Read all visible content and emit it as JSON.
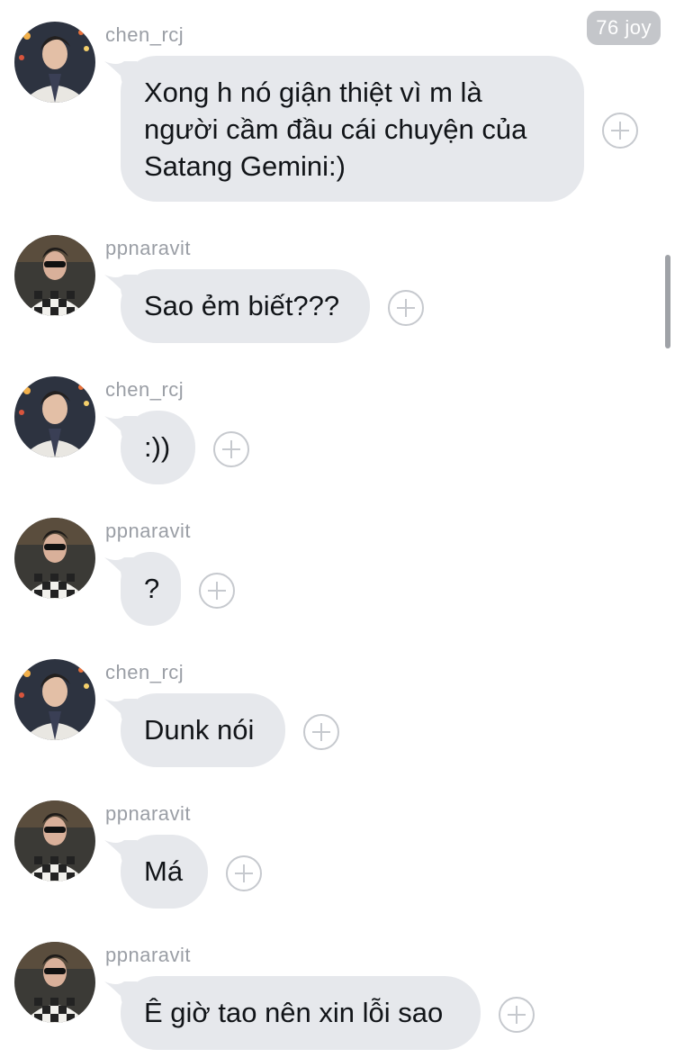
{
  "header": {
    "points_badge": "76 joy"
  },
  "colors": {
    "bubble_bg": "#e6e8ec",
    "username_text": "#9a9ea5",
    "react_button": "#c6c9ce",
    "badge_bg": "#c4c6ca"
  },
  "avatar_icons": {
    "chen_rcj": "user-avatar-chen-icon",
    "ppnaravit": "user-avatar-pp-icon"
  },
  "messages": [
    {
      "username": "chen_rcj",
      "text": "Xong h nó giận thiệt vì m là người cầm đầu cái chuyện của Satang Gemini:)"
    },
    {
      "username": "ppnaravit",
      "text": "Sao ẻm biết???"
    },
    {
      "username": "chen_rcj",
      "text": ":))"
    },
    {
      "username": "ppnaravit",
      "text": "?"
    },
    {
      "username": "chen_rcj",
      "text": "Dunk nói"
    },
    {
      "username": "ppnaravit",
      "text": "Má"
    },
    {
      "username": "ppnaravit",
      "text": "Ê giờ tao nên xin lỗi sao"
    }
  ]
}
